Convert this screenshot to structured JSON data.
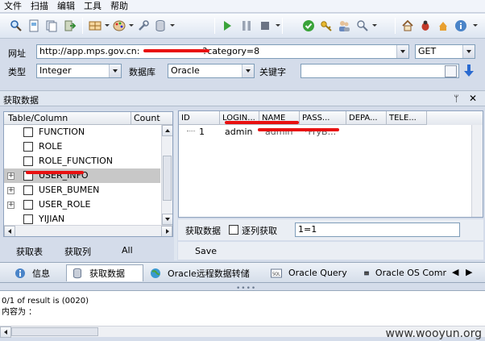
{
  "menu": [
    "文件",
    "扫描",
    "编辑",
    "工具",
    "帮助"
  ],
  "form": {
    "url_label": "网址",
    "url_value": "http://app.mps.gov.cn:",
    "url_tail": "?category=8",
    "method": "GET",
    "type_label": "类型",
    "type_value": "Integer",
    "db_label": "数据库",
    "db_value": "Oracle",
    "keyword_label": "关键字",
    "keyword_value": ""
  },
  "panel_title": "获取数据",
  "tree": {
    "col_table": "Table/Column",
    "col_count": "Count",
    "items": [
      {
        "label": "FUNCTION"
      },
      {
        "label": "ROLE"
      },
      {
        "label": "ROLE_FUNCTION"
      },
      {
        "label": "USER_INFO"
      },
      {
        "label": "USER_BUMEN"
      },
      {
        "label": "USER_ROLE"
      },
      {
        "label": "YIJIAN"
      }
    ]
  },
  "left_actions": {
    "fetch_tables": "获取表",
    "fetch_columns": "获取列",
    "all": "All"
  },
  "grid": {
    "columns": [
      "ID",
      "LOGIN...",
      "NAME",
      "PASS...",
      "DEPA...",
      "TELE..."
    ],
    "rows": [
      [
        "1",
        "admin",
        "admin",
        "*FryB..."
      ]
    ]
  },
  "fetch_bar": {
    "label": "获取数据",
    "checkbox_label": "逐列获取",
    "condition": "1=1",
    "save": "Save"
  },
  "tabs": [
    {
      "label": "信息",
      "icon": "info-icon"
    },
    {
      "label": "获取数据",
      "icon": "database-icon"
    },
    {
      "label": "Oracle远程数据转储",
      "icon": "globe-icon"
    },
    {
      "label": "Oracle Query",
      "icon": "sql-icon"
    },
    {
      "label": "Oracle OS Comr",
      "icon": "terminal-icon"
    }
  ],
  "result": {
    "line1": "0/1 of result is (0020)",
    "line2": "内容为 ："
  },
  "watermark": "www.wooyun.org"
}
